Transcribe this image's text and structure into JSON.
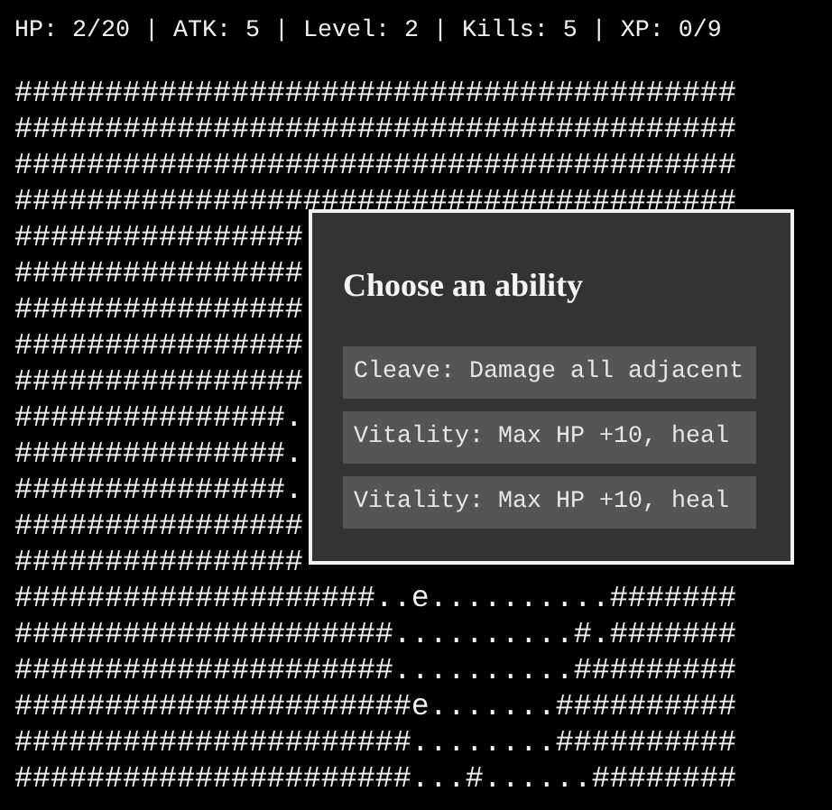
{
  "status": "HP: 2/20 | ATK: 5 | Level: 2 | Kills: 5 | XP: 0/9",
  "map_rows": [
    "########################################",
    "########################################",
    "########################################",
    "########################################",
    "################",
    "################",
    "################",
    "################",
    "################",
    "###############.",
    "###############.",
    "###############.",
    "################",
    "################",
    "####################..e..........#######",
    "#####################..........#.#######",
    "#####################..........#########",
    "######################e.......##########",
    "######################........##########",
    "######################...#......########"
  ],
  "dialog": {
    "title": "Choose an ability",
    "options": [
      {
        "label": "Cleave: Damage all adjacent"
      },
      {
        "label": "Vitality: Max HP +10, heal"
      },
      {
        "label": "Vitality: Max HP +10, heal"
      }
    ]
  }
}
